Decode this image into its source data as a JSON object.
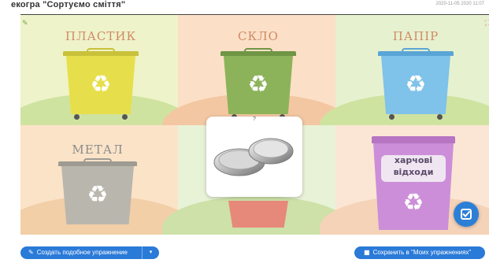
{
  "header": {
    "title": "екогра \"Сортуємо сміття\"",
    "timestamp": "2020-11-05 2020 11:07"
  },
  "bins": [
    {
      "label": "ПЛАСТИК",
      "color": "#e8e04a"
    },
    {
      "label": "СКЛО",
      "color": "#8fb55a"
    },
    {
      "label": "ПАПІР",
      "color": "#7fc2ea"
    },
    {
      "label": "МЕТАЛ",
      "color": "#b9b6ae"
    },
    {
      "label": "",
      "color": "#e7897a"
    },
    {
      "label": "харчові відходи",
      "color": "#cc8ed8"
    }
  ],
  "item_card": {
    "hint": "?",
    "item": "metal tin"
  },
  "buttons": {
    "create_similar": "Создать подобное упражнение",
    "save": "Сохранить в \"Моих упражнениях\""
  },
  "colors": {
    "accent": "#2a7ad8",
    "float_button": "#2d7fd6"
  }
}
